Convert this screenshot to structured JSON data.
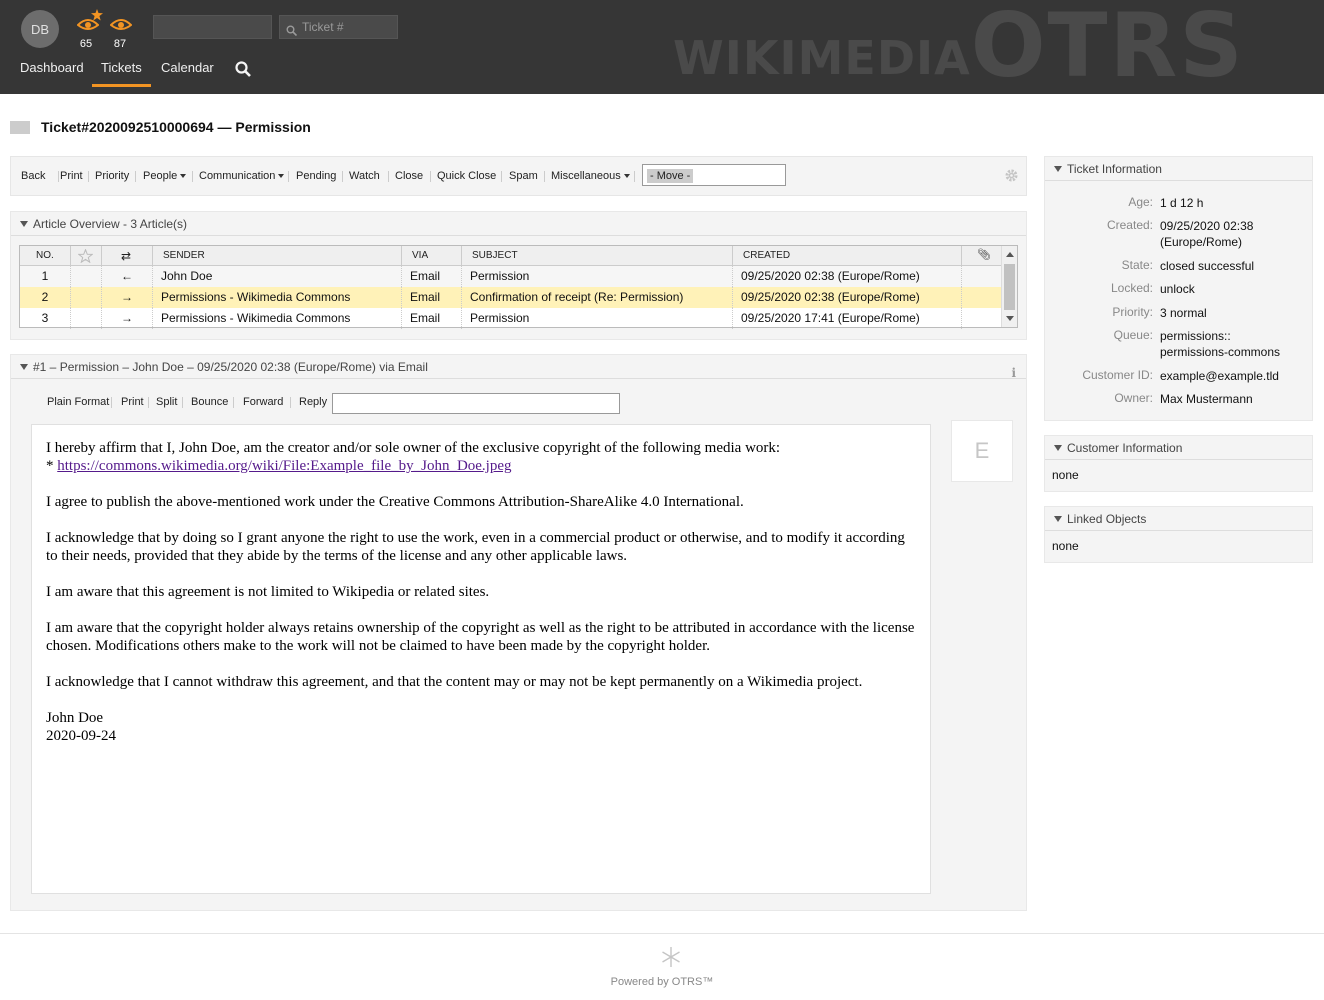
{
  "header": {
    "avatar_initials": "DB",
    "watch_counts": {
      "escalated": "65",
      "watched": "87"
    },
    "search_placeholder": "Ticket #",
    "nav": [
      "Dashboard",
      "Tickets",
      "Calendar"
    ],
    "active_nav": "Tickets",
    "brand_left": "WIKIMEDIA",
    "brand_right": "OTRS"
  },
  "ticket": {
    "title": "Ticket#2020092510000694 — Permission"
  },
  "actions": {
    "items": [
      "Back",
      "Print",
      "Priority",
      "People",
      "Communication",
      "Pending",
      "Watch",
      "Close",
      "Quick Close",
      "Spam",
      "Miscellaneous"
    ],
    "move_placeholder": "- Move -"
  },
  "article_overview": {
    "title": "Article Overview - 3 Article(s)",
    "columns": [
      "NO.",
      "",
      "",
      "SENDER",
      "VIA",
      "SUBJECT",
      "CREATED",
      ""
    ],
    "rows": [
      {
        "no": "1",
        "direction": "←",
        "sender": "John Doe",
        "via": "Email",
        "subject": "Permission",
        "created": "09/25/2020 02:38 (Europe/Rome)"
      },
      {
        "no": "2",
        "direction": "→",
        "sender": "Permissions - Wikimedia Commons",
        "via": "Email",
        "subject": "Confirmation of receipt (Re: Permission)",
        "created": "09/25/2020 02:38 (Europe/Rome)"
      },
      {
        "no": "3",
        "direction": "→",
        "sender": "Permissions - Wikimedia Commons",
        "via": "Email",
        "subject": "Permission",
        "created": "09/25/2020 17:41 (Europe/Rome)"
      }
    ]
  },
  "article": {
    "title": "#1 – Permission – John Doe – 09/25/2020 02:38 (Europe/Rome) via Email",
    "menu": [
      "Plain Format",
      "Print",
      "Split",
      "Bounce",
      "Forward",
      "Reply"
    ],
    "avatar_letter": "E",
    "body": {
      "line1": "I hereby affirm that I, John Doe, am the creator and/or sole owner of the exclusive copyright of the following media work:",
      "bullet": "* ",
      "link": "https://commons.wikimedia.org/wiki/File:Example_file_by_John_Doe.jpeg",
      "p2": "I agree to publish the above-mentioned work under the Creative Commons Attribution-ShareAlike 4.0 International.",
      "p3": "I acknowledge that by doing so I grant anyone the right to use the work, even in a commercial product or otherwise, and to modify it according to their needs, provided that they abide by the terms of the license and any other applicable laws.",
      "p4": "I am aware that this agreement is not limited to Wikipedia or related sites.",
      "p5": "I am aware that the copyright holder always retains ownership of the copyright as well as the right to be attributed in accordance with the license chosen. Modifications others make to the work will not be claimed to have been made by the copyright holder.",
      "p6": "I acknowledge that I cannot withdraw this agreement, and that the content may or may not be kept permanently on a Wikimedia project.",
      "sig_name": "John Doe",
      "sig_date": "2020-09-24"
    }
  },
  "ticket_info": {
    "title": "Ticket Information",
    "fields": [
      {
        "label": "Age:",
        "value": "1 d 12 h"
      },
      {
        "label": "Created:",
        "value": "09/25/2020 02:38 (Europe/Rome)"
      },
      {
        "label": "State:",
        "value": "closed successful"
      },
      {
        "label": "Locked:",
        "value": "unlock"
      },
      {
        "label": "Priority:",
        "value": "3 normal"
      },
      {
        "label": "Queue:",
        "value": "permissions:: permissions-commons"
      },
      {
        "label": "Customer ID:",
        "value": "example@example.tld"
      },
      {
        "label": "Owner:",
        "value": "Max Mustermann"
      }
    ]
  },
  "customer_info": {
    "title": "Customer Information",
    "value": "none"
  },
  "linked_objects": {
    "title": "Linked Objects",
    "value": "none"
  },
  "footer": {
    "text": "Powered by OTRS™"
  },
  "colors": {
    "header_bg": "#363636",
    "accent": "#f29423",
    "selected_row": "#fff2b8"
  },
  "icons": [
    "eye-escalated-icon",
    "eye-watched-icon",
    "search-icon",
    "star-icon",
    "direction-icon",
    "attachment-icon",
    "gear-icon",
    "info-icon",
    "otrs-snowflake-icon"
  ]
}
